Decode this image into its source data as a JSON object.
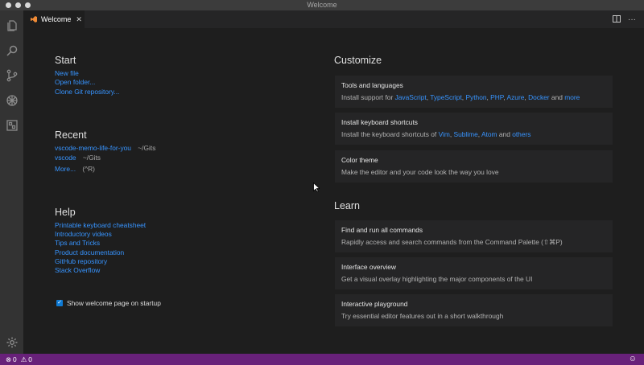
{
  "window": {
    "title": "Welcome"
  },
  "tab": {
    "label": "Welcome",
    "close": "✕"
  },
  "start": {
    "heading": "Start",
    "links": [
      "New file",
      "Open folder...",
      "Clone Git repository..."
    ]
  },
  "recent": {
    "heading": "Recent",
    "items": [
      {
        "name": "vscode-memo-life-for-you",
        "path": "~/Gits"
      },
      {
        "name": "vscode",
        "path": "~/Gits"
      }
    ],
    "more": "More...",
    "more_shortcut": "(^R)"
  },
  "help": {
    "heading": "Help",
    "links": [
      "Printable keyboard cheatsheet",
      "Introductory videos",
      "Tips and Tricks",
      "Product documentation",
      "GitHub repository",
      "Stack Overflow"
    ]
  },
  "startup": {
    "label": "Show welcome page on startup",
    "checked": true
  },
  "customize": {
    "heading": "Customize",
    "tools": {
      "title": "Tools and languages",
      "prefix": "Install support for ",
      "links": [
        "JavaScript",
        "TypeScript",
        "Python",
        "PHP",
        "Azure",
        "Docker"
      ],
      "and": " and ",
      "more": "more"
    },
    "keys": {
      "title": "Install keyboard shortcuts",
      "prefix": "Install the keyboard shortcuts of ",
      "links": [
        "Vim",
        "Sublime",
        "Atom"
      ],
      "and": " and ",
      "others": "others"
    },
    "theme": {
      "title": "Color theme",
      "desc": "Make the editor and your code look the way you love"
    }
  },
  "learn": {
    "heading": "Learn",
    "cards": [
      {
        "title": "Find and run all commands",
        "desc": "Rapidly access and search commands from the Command Palette (⇧⌘P)"
      },
      {
        "title": "Interface overview",
        "desc": "Get a visual overlay highlighting the major components of the UI"
      },
      {
        "title": "Interactive playground",
        "desc": "Try essential editor features out in a short walkthrough"
      }
    ]
  },
  "status": {
    "errors": "0",
    "warnings": "0",
    "feedback_icon": "smiley-icon"
  },
  "colors": {
    "statusbar": "#68217a",
    "link": "#3794ff",
    "activitybar": "#333333",
    "editor": "#1e1e1e"
  }
}
